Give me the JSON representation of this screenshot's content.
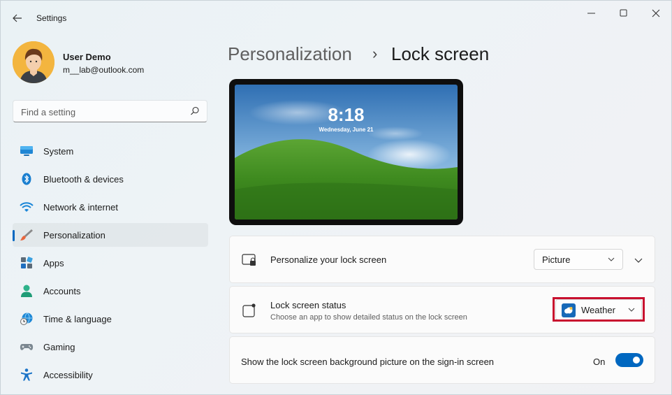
{
  "window": {
    "title": "Settings"
  },
  "user": {
    "name": "User Demo",
    "email": "m__lab@outlook.com"
  },
  "search": {
    "placeholder": "Find a setting"
  },
  "sidebar": {
    "items": [
      {
        "label": "System",
        "icon": "monitor-icon"
      },
      {
        "label": "Bluetooth & devices",
        "icon": "bluetooth-icon"
      },
      {
        "label": "Network & internet",
        "icon": "wifi-icon"
      },
      {
        "label": "Personalization",
        "icon": "brush-icon",
        "active": true
      },
      {
        "label": "Apps",
        "icon": "apps-icon"
      },
      {
        "label": "Accounts",
        "icon": "person-icon"
      },
      {
        "label": "Time & language",
        "icon": "globe-clock-icon"
      },
      {
        "label": "Gaming",
        "icon": "gamepad-icon"
      },
      {
        "label": "Accessibility",
        "icon": "accessibility-icon"
      }
    ]
  },
  "breadcrumb": {
    "parent": "Personalization",
    "separator": "›",
    "current": "Lock screen"
  },
  "preview": {
    "time": "8:18",
    "date": "Wednesday, June 21"
  },
  "settings": {
    "personalize": {
      "title": "Personalize your lock screen",
      "value": "Picture"
    },
    "status": {
      "title": "Lock screen status",
      "subtitle": "Choose an app to show detailed status on the lock screen",
      "value": "Weather"
    },
    "signin": {
      "title": "Show the lock screen background picture on the sign-in screen",
      "state_label": "On",
      "enabled": true
    }
  },
  "colors": {
    "accent": "#0067c0",
    "highlight": "#c8102e"
  }
}
